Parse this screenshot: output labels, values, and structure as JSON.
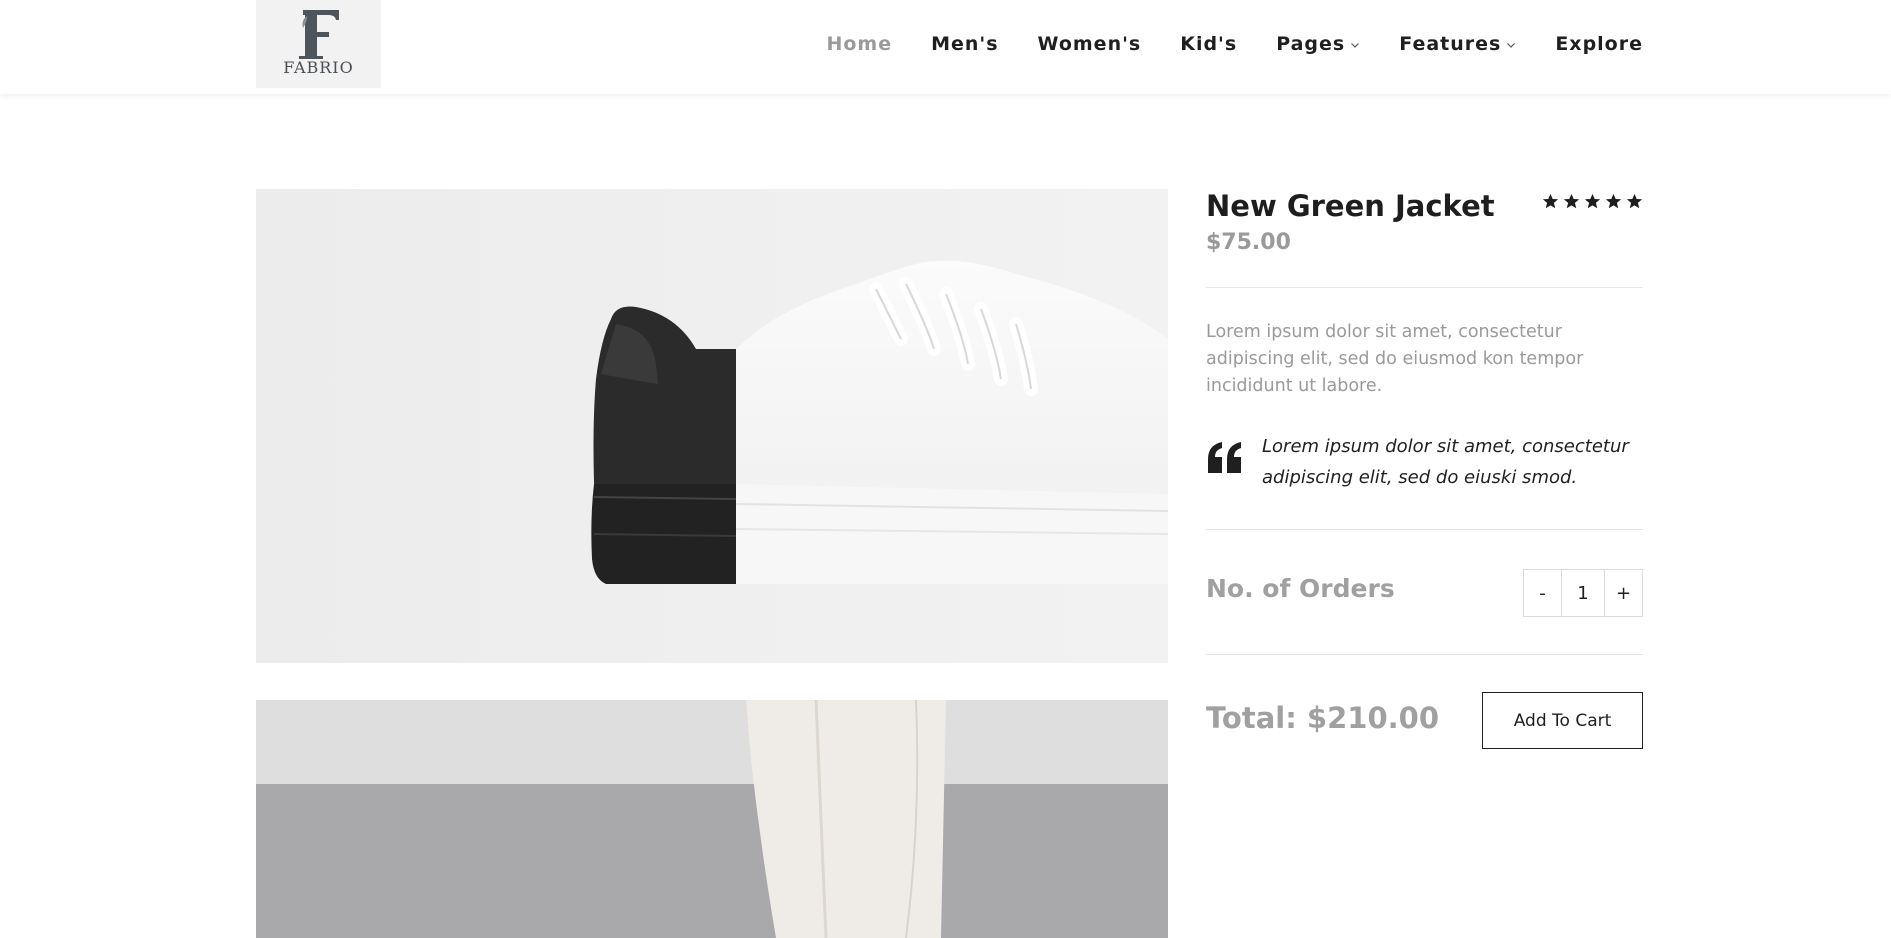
{
  "brand": {
    "logo_text": "FABRIO"
  },
  "nav": {
    "items": [
      {
        "label": "Home"
      },
      {
        "label": "Men's"
      },
      {
        "label": "Women's"
      },
      {
        "label": "Kid's"
      },
      {
        "label": "Pages"
      },
      {
        "label": "Features"
      },
      {
        "label": "Explore"
      }
    ]
  },
  "product": {
    "title": "New Green Jacket",
    "rating": 5,
    "rating_max": 5,
    "price": "$75.00",
    "description": "Lorem ipsum dolor sit amet, consectetur adipiscing elit, sed do eiusmod kon tempor incididunt ut labore.",
    "quote": "Lorem ipsum dolor sit amet, consectetur adipiscing elit, sed do eiuski smod.",
    "orders_label": "No. of Orders",
    "quantity": "1",
    "minus_label": "-",
    "plus_label": "+",
    "total": "Total: $210.00",
    "add_to_cart": "Add To Cart"
  },
  "colors": {
    "text_dark": "#1f1f1f",
    "text_muted": "#9a9a9a",
    "nav_active": "#9a9a9a",
    "divider": "#e6e6e6"
  }
}
